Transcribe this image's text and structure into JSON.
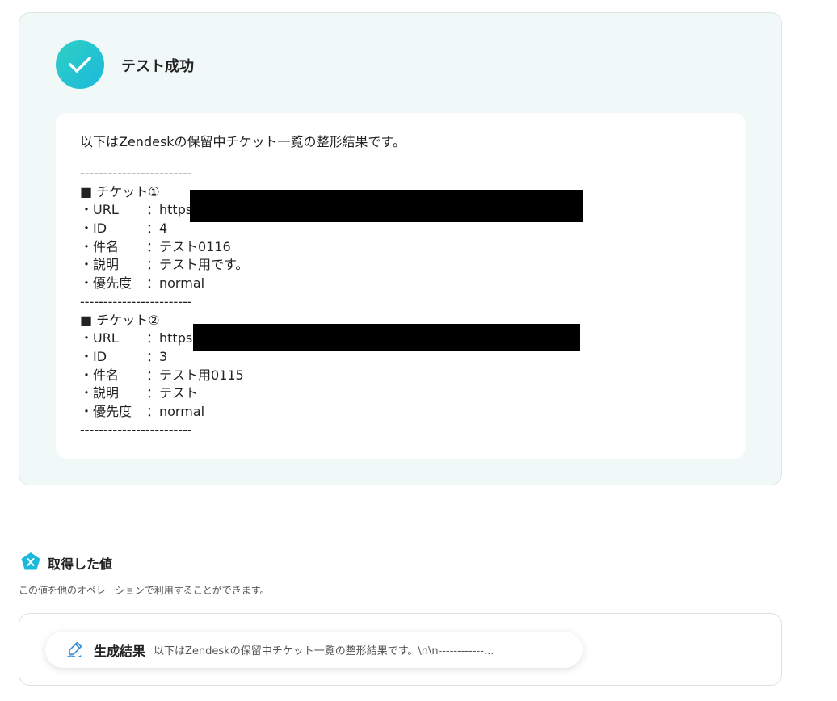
{
  "test_result": {
    "title": "テスト成功",
    "intro": "以下はZendeskの保留中チケット一覧の整形結果です。",
    "divider": "------------------------",
    "tickets": [
      {
        "heading": "■ チケット①",
        "url_label": "・URL",
        "url_value": "：https:",
        "id_label": "・ID",
        "id_value": "：4",
        "subject_label": "・件名",
        "subject_value": "：テスト0116",
        "desc_label": "・説明",
        "desc_value": "：テスト用です。",
        "priority_label": "・優先度",
        "priority_value": "：normal"
      },
      {
        "heading": "■ チケット②",
        "url_label": "・URL",
        "url_value": "：https:",
        "id_label": "・ID",
        "id_value": "：3",
        "subject_label": "・件名",
        "subject_value": "：テスト用0115",
        "desc_label": "・説明",
        "desc_value": "：テスト",
        "priority_label": "・優先度",
        "priority_value": "：normal"
      }
    ]
  },
  "obtained_values": {
    "title": "取得した値",
    "description": "この値を他のオペレーションで利用することができます。",
    "chip_label": "生成結果",
    "chip_value": "以下はZendeskの保留中チケット一覧の整形結果です。\\n\\n------------..."
  },
  "colors": {
    "accent_gradient_start": "#2fd0c4",
    "accent_gradient_end": "#1bb9dc",
    "panel_bg": "#f1f9f8"
  }
}
